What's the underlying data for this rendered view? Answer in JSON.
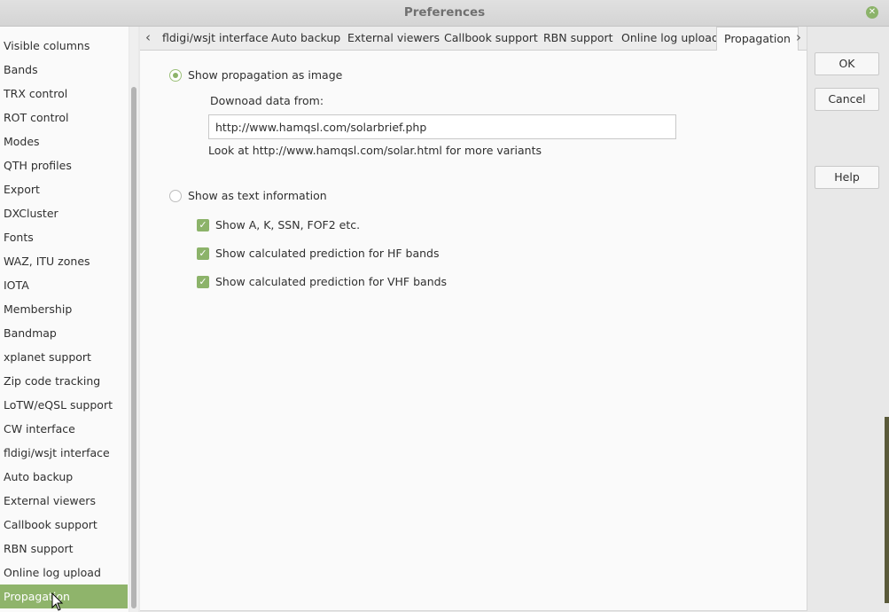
{
  "window": {
    "title": "Preferences"
  },
  "sidebar": {
    "items": [
      {
        "label": "Visible columns"
      },
      {
        "label": "Bands"
      },
      {
        "label": "TRX control"
      },
      {
        "label": "ROT control"
      },
      {
        "label": "Modes"
      },
      {
        "label": "QTH profiles"
      },
      {
        "label": "Export"
      },
      {
        "label": "DXCluster"
      },
      {
        "label": "Fonts"
      },
      {
        "label": "WAZ, ITU zones"
      },
      {
        "label": "IOTA"
      },
      {
        "label": "Membership"
      },
      {
        "label": "Bandmap"
      },
      {
        "label": "xplanet support"
      },
      {
        "label": "Zip code tracking"
      },
      {
        "label": "LoTW/eQSL support"
      },
      {
        "label": "CW interface"
      },
      {
        "label": "fldigi/wsjt interface"
      },
      {
        "label": "Auto backup"
      },
      {
        "label": "External viewers"
      },
      {
        "label": "Callbook support"
      },
      {
        "label": "RBN support"
      },
      {
        "label": "Online log upload"
      },
      {
        "label": "Propagation"
      }
    ],
    "selected": "Propagation"
  },
  "tabs": [
    {
      "label": "fldigi/wsjt interface"
    },
    {
      "label": "Auto backup"
    },
    {
      "label": "External viewers"
    },
    {
      "label": "Callbook support"
    },
    {
      "label": "RBN support"
    },
    {
      "label": "Online log upload"
    },
    {
      "label": "Propagation"
    }
  ],
  "propagation": {
    "image_option": {
      "label": "Show propagation as image",
      "checked": true
    },
    "download_label": "Downoad data from:",
    "url_value": "http://www.hamqsl.com/solarbrief.php",
    "hint": "Look at http://www.hamqsl.com/solar.html for more variants",
    "text_option": {
      "label": "Show as text information",
      "checked": false
    },
    "checkboxes": [
      {
        "label": "Show A, K, SSN, FOF2 etc.",
        "checked": true
      },
      {
        "label": "Show calculated prediction for HF bands",
        "checked": true
      },
      {
        "label": "Show calculated prediction for VHF bands",
        "checked": true
      }
    ]
  },
  "buttons": {
    "ok": "OK",
    "cancel": "Cancel",
    "help": "Help"
  },
  "colors": {
    "accent": "#8cb36a",
    "selected_bg": "#8fb46b"
  }
}
